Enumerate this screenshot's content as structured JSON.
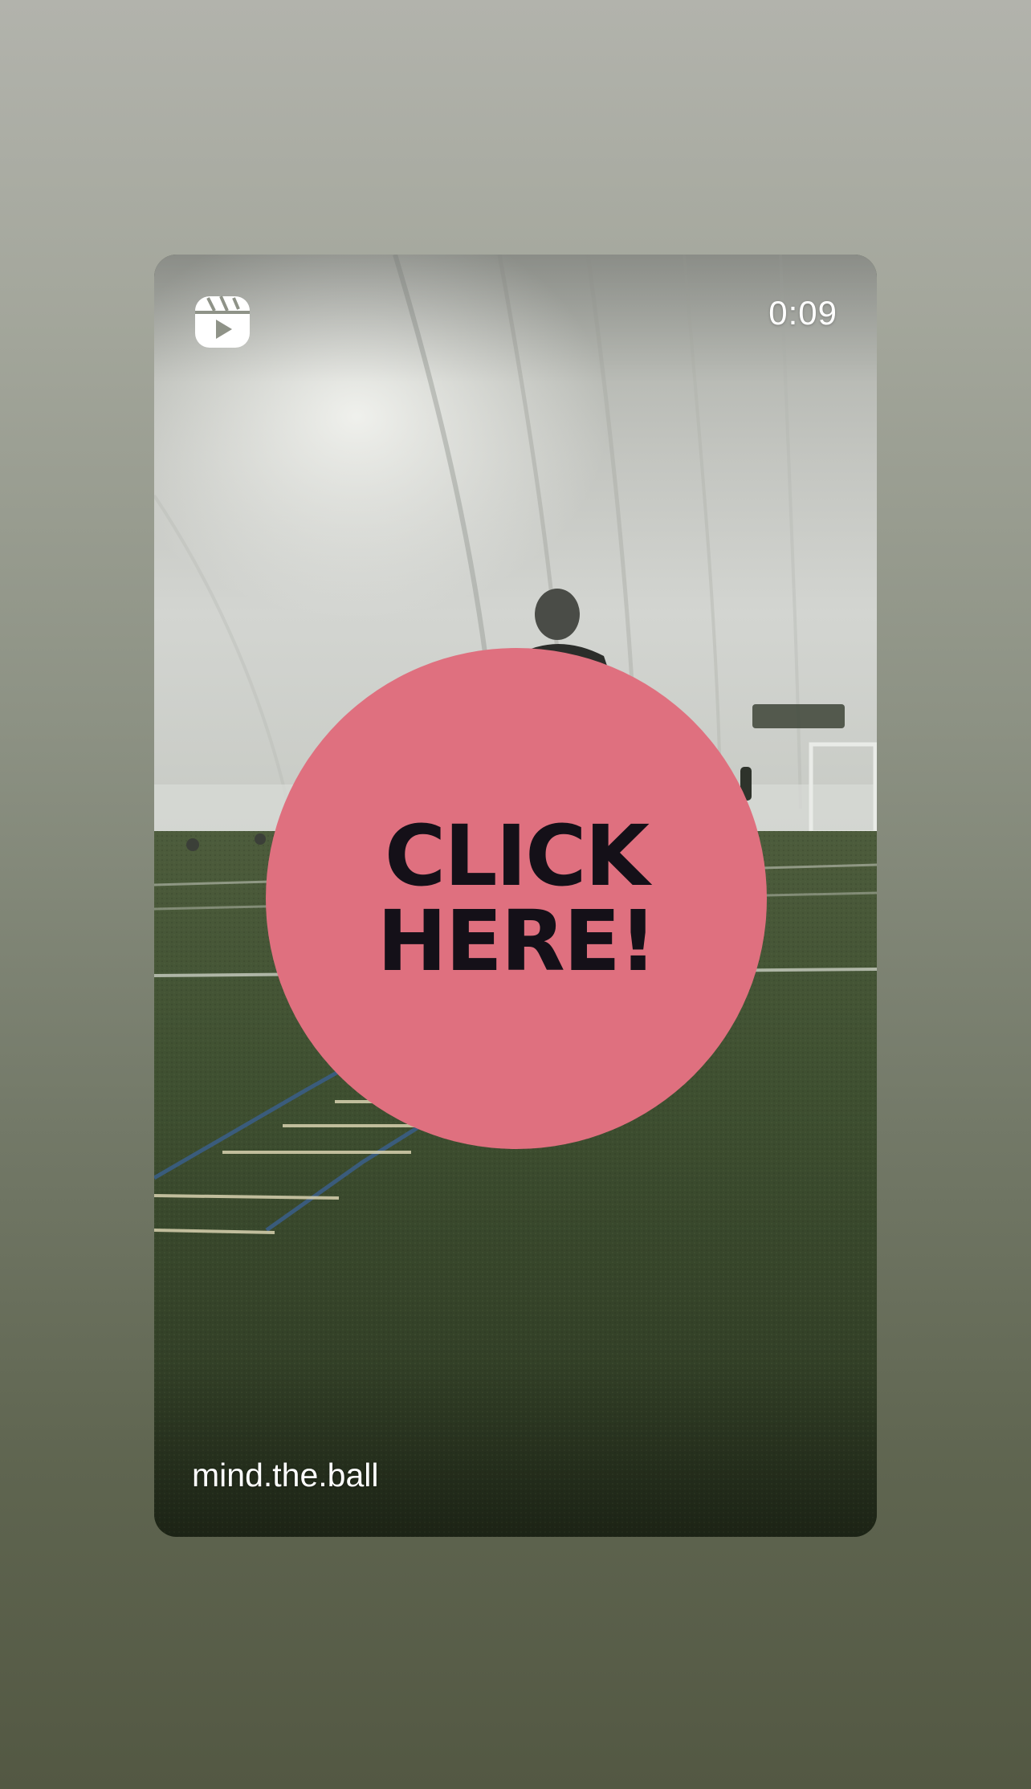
{
  "background": {
    "gradient_top": "#b2b3ac",
    "gradient_bottom": "#535843"
  },
  "story": {
    "media_type_icon": "reels-icon",
    "duration": "0:09",
    "username": "mind.the.ball",
    "scene_description": "indoor-turf-training-dome"
  },
  "sticker": {
    "line1": "CLICK",
    "line2": "HERE!",
    "color": "#df707f",
    "text_color": "#141018"
  }
}
